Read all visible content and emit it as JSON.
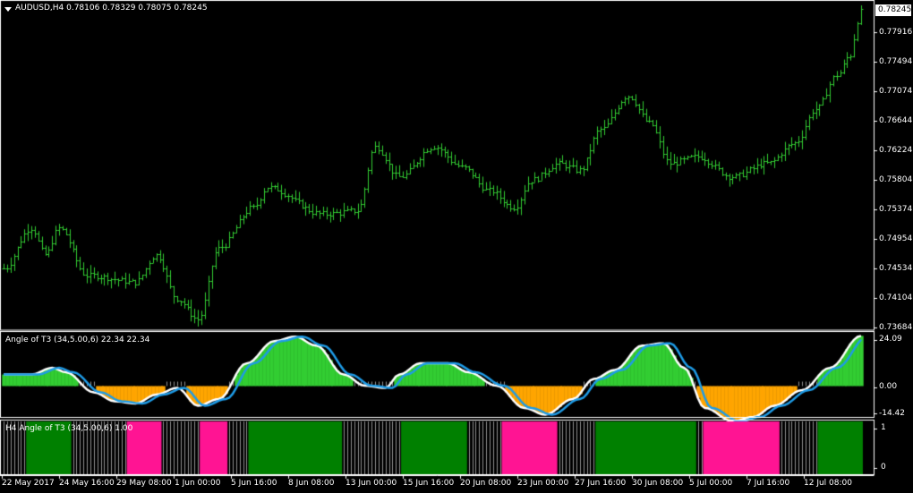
{
  "colors": {
    "background": "#000000",
    "frame": "#ffffff",
    "candle": "#32cd32",
    "hist_positive": "#32cd32",
    "hist_negative": "#ffa500",
    "hist_neutral": "#909090",
    "line_main": "#ffffff",
    "line_signal": "#1e9be6",
    "bar_green": "#008000",
    "bar_magenta": "#ff1493",
    "bar_gray": "#909090"
  },
  "main_panel": {
    "symbol_label": "AUDUSD,H4  0.78106 0.78329 0.78075 0.78245",
    "current_price": "0.78245",
    "price_labels": [
      "0.77916",
      "0.77494",
      "0.77074",
      "0.76644",
      "0.76224",
      "0.75804",
      "0.75374",
      "0.74954",
      "0.74534",
      "0.74104",
      "0.73684"
    ]
  },
  "indicator_panel": {
    "label": "Angle of T3 (34,5.00,6) 22.34 22.34",
    "scale_labels": [
      "24.09",
      "0.00",
      "-14.42"
    ]
  },
  "bars_panel": {
    "label": "H4 Angle of T3 (34,5.00,6) 1.00",
    "scale_labels": [
      "1",
      "0"
    ]
  },
  "time_axis": [
    "22 May 2017",
    "24 May 16:00",
    "29 May 08:00",
    "1 Jun 00:00",
    "5 Jun 16:00",
    "8 Jun 08:00",
    "13 Jun 00:00",
    "15 Jun 16:00",
    "20 Jun 08:00",
    "23 Jun 00:00",
    "27 Jun 16:00",
    "30 Jun 08:00",
    "5 Jul 00:00",
    "7 Jul 16:00",
    "12 Jul 08:00"
  ],
  "chart_data": [
    {
      "type": "candlestick",
      "title": "AUDUSD,H4  0.78106 0.78329 0.78075 0.78245",
      "ylim": [
        0.7355,
        0.7837
      ],
      "keyframes": [
        {
          "bar": 0,
          "close": 0.7445
        },
        {
          "bar": 8,
          "close": 0.7505
        },
        {
          "bar": 12,
          "close": 0.7465
        },
        {
          "bar": 16,
          "close": 0.7505
        },
        {
          "bar": 24,
          "close": 0.7435
        },
        {
          "bar": 38,
          "close": 0.7425
        },
        {
          "bar": 44,
          "close": 0.7465
        },
        {
          "bar": 50,
          "close": 0.74
        },
        {
          "bar": 56,
          "close": 0.737
        },
        {
          "bar": 62,
          "close": 0.7475
        },
        {
          "bar": 72,
          "close": 0.7535
        },
        {
          "bar": 76,
          "close": 0.7565
        },
        {
          "bar": 92,
          "close": 0.7525
        },
        {
          "bar": 102,
          "close": 0.753
        },
        {
          "bar": 107,
          "close": 0.7625
        },
        {
          "bar": 114,
          "close": 0.758
        },
        {
          "bar": 124,
          "close": 0.7625
        },
        {
          "bar": 132,
          "close": 0.7595
        },
        {
          "bar": 140,
          "close": 0.756
        },
        {
          "bar": 147,
          "close": 0.7535
        },
        {
          "bar": 152,
          "close": 0.7575
        },
        {
          "bar": 160,
          "close": 0.76
        },
        {
          "bar": 166,
          "close": 0.759
        },
        {
          "bar": 172,
          "close": 0.765
        },
        {
          "bar": 180,
          "close": 0.77
        },
        {
          "bar": 186,
          "close": 0.766
        },
        {
          "bar": 192,
          "close": 0.76
        },
        {
          "bar": 200,
          "close": 0.761
        },
        {
          "bar": 210,
          "close": 0.758
        },
        {
          "bar": 220,
          "close": 0.76
        },
        {
          "bar": 228,
          "close": 0.763
        },
        {
          "bar": 234,
          "close": 0.768
        },
        {
          "bar": 240,
          "close": 0.773
        },
        {
          "bar": 244,
          "close": 0.776
        },
        {
          "bar": 246,
          "close": 0.781
        },
        {
          "bar": 247,
          "close": 0.7824
        }
      ],
      "bar_count": 248
    },
    {
      "type": "area",
      "title": "Angle of T3 (34,5.00,6) 22.34 22.34",
      "ylim": [
        -14.42,
        24.09
      ],
      "keyframes": [
        {
          "bar": 0,
          "value": 5
        },
        {
          "bar": 8,
          "value": 5
        },
        {
          "bar": 14,
          "value": 8
        },
        {
          "bar": 18,
          "value": 6
        },
        {
          "bar": 26,
          "value": -3
        },
        {
          "bar": 32,
          "value": -7
        },
        {
          "bar": 38,
          "value": -8
        },
        {
          "bar": 44,
          "value": -4
        },
        {
          "bar": 50,
          "value": -1
        },
        {
          "bar": 56,
          "value": -9
        },
        {
          "bar": 62,
          "value": -6
        },
        {
          "bar": 70,
          "value": 10
        },
        {
          "bar": 78,
          "value": 20
        },
        {
          "bar": 84,
          "value": 22
        },
        {
          "bar": 90,
          "value": 18
        },
        {
          "bar": 98,
          "value": 5
        },
        {
          "bar": 104,
          "value": 0
        },
        {
          "bar": 110,
          "value": -1
        },
        {
          "bar": 114,
          "value": 5
        },
        {
          "bar": 120,
          "value": 10
        },
        {
          "bar": 128,
          "value": 10
        },
        {
          "bar": 134,
          "value": 6
        },
        {
          "bar": 142,
          "value": 0
        },
        {
          "bar": 150,
          "value": -10
        },
        {
          "bar": 156,
          "value": -13
        },
        {
          "bar": 164,
          "value": -6
        },
        {
          "bar": 170,
          "value": 3
        },
        {
          "bar": 176,
          "value": 7
        },
        {
          "bar": 184,
          "value": 18
        },
        {
          "bar": 190,
          "value": 19
        },
        {
          "bar": 196,
          "value": 8
        },
        {
          "bar": 202,
          "value": -10
        },
        {
          "bar": 210,
          "value": -16
        },
        {
          "bar": 216,
          "value": -14
        },
        {
          "bar": 222,
          "value": -9
        },
        {
          "bar": 230,
          "value": -2
        },
        {
          "bar": 238,
          "value": 8
        },
        {
          "bar": 247,
          "value": 22.34
        }
      ],
      "bar_count": 248
    },
    {
      "type": "bar",
      "title": "H4 Angle of T3 (34,5.00,6) 1.00",
      "ylim": [
        0,
        1
      ],
      "segments": [
        {
          "from": 0,
          "to": 6,
          "state": "gray"
        },
        {
          "from": 7,
          "to": 19,
          "state": "green"
        },
        {
          "from": 20,
          "to": 35,
          "state": "gray"
        },
        {
          "from": 36,
          "to": 45,
          "state": "magenta"
        },
        {
          "from": 46,
          "to": 56,
          "state": "gray"
        },
        {
          "from": 57,
          "to": 64,
          "state": "magenta"
        },
        {
          "from": 65,
          "to": 70,
          "state": "gray"
        },
        {
          "from": 71,
          "to": 97,
          "state": "green"
        },
        {
          "from": 98,
          "to": 114,
          "state": "gray"
        },
        {
          "from": 115,
          "to": 133,
          "state": "green"
        },
        {
          "from": 134,
          "to": 143,
          "state": "gray"
        },
        {
          "from": 144,
          "to": 159,
          "state": "magenta"
        },
        {
          "from": 160,
          "to": 170,
          "state": "gray"
        },
        {
          "from": 171,
          "to": 199,
          "state": "green"
        },
        {
          "from": 200,
          "to": 201,
          "state": "gray"
        },
        {
          "from": 202,
          "to": 223,
          "state": "magenta"
        },
        {
          "from": 224,
          "to": 234,
          "state": "gray"
        },
        {
          "from": 235,
          "to": 247,
          "state": "green"
        }
      ],
      "bar_count": 248
    }
  ]
}
